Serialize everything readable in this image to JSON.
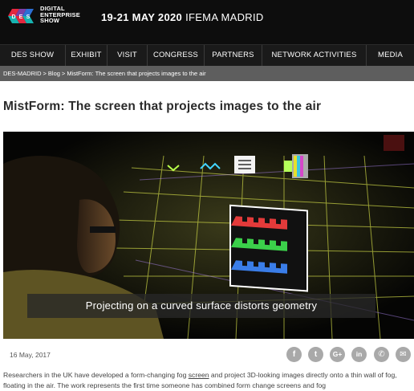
{
  "header": {
    "logo_letters": [
      "D",
      "E",
      "S"
    ],
    "logo_lines": [
      "DIGITAL",
      "ENTERPRISE",
      "SHOW"
    ],
    "dates": "19-21 MAY 2020",
    "venue": "IFEMA MADRID"
  },
  "nav": {
    "items": [
      {
        "label": "DES SHOW"
      },
      {
        "label": "EXHIBIT"
      },
      {
        "label": "VISIT"
      },
      {
        "label": "CONGRESS"
      },
      {
        "label": "PARTNERS"
      },
      {
        "label": "NETWORK ACTIVITIES"
      },
      {
        "label": "MEDIA"
      }
    ]
  },
  "breadcrumb": {
    "home": "DES-MADRID",
    "separator": ">",
    "blog": "Blog",
    "current": "MistForm: The screen that projects images to the air"
  },
  "article": {
    "title": "MistForm: The screen that projects images to the air",
    "image_caption": "Projecting on a curved surface distorts geometry",
    "date": "16 May, 2017",
    "body_before_link": "Researchers in the UK have developed a form-changing fog ",
    "body_link": "screen",
    "body_after_link": " and project 3D-looking images directly onto a thin wall of fog, floating in the air. The work represents the first time someone has combined form change screens and fog"
  },
  "share": {
    "icons": [
      "facebook-icon",
      "twitter-icon",
      "google-plus-icon",
      "linkedin-icon",
      "whatsapp-icon",
      "email-icon"
    ],
    "glyphs": [
      "f",
      "t",
      "G+",
      "in",
      "✆",
      "✉"
    ]
  },
  "colors": {
    "topbar": "#0d0d0d",
    "nav": "#1a1a1a",
    "breadcrumb": "#5e5e5e",
    "share_icon": "#a9a9a9",
    "logo_red": "#e4273f",
    "logo_blue": "#2c6fd4",
    "logo_teal": "#17b3b0",
    "logo_purple": "#7a3fa8"
  }
}
